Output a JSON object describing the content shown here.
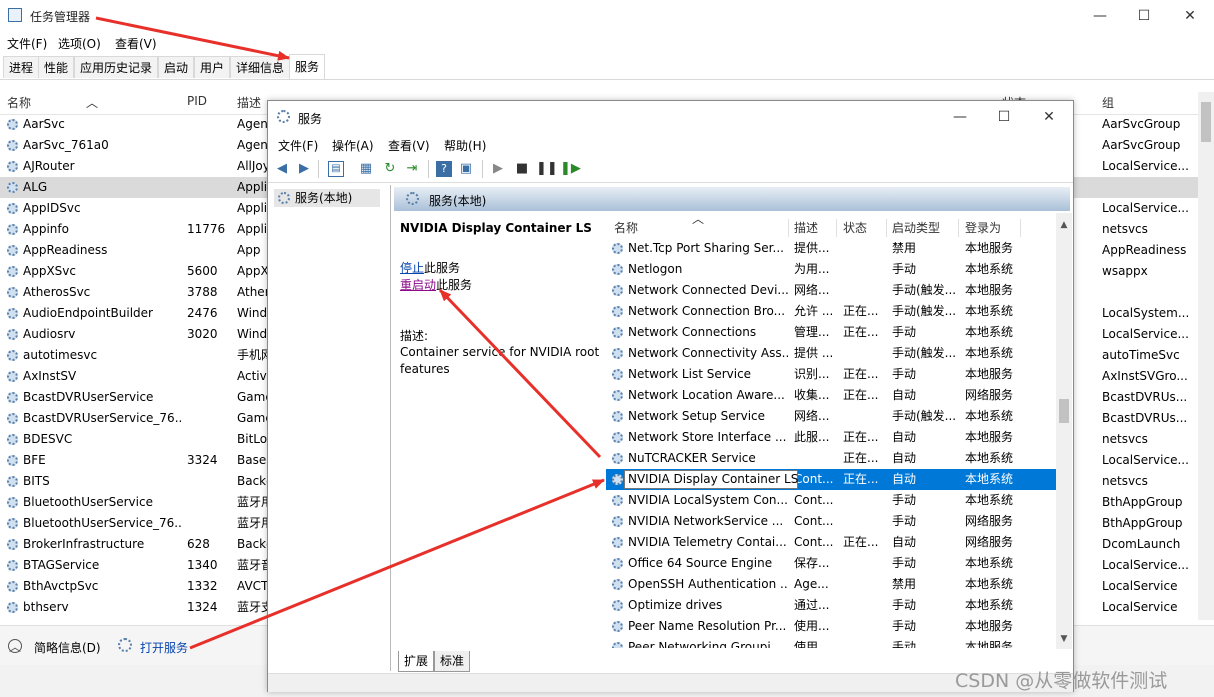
{
  "taskmgr": {
    "title": "任务管理器",
    "controls": {
      "min": "—",
      "max": "☐",
      "close": "✕"
    },
    "menu": [
      "文件(F)",
      "选项(O)",
      "查看(V)"
    ],
    "tabs": [
      "进程",
      "性能",
      "应用历史记录",
      "启动",
      "用户",
      "详细信息",
      "服务"
    ],
    "active_tab": "服务",
    "columns": {
      "name": "名称",
      "pid": "PID",
      "desc": "描述",
      "status": "状态",
      "group": "组"
    },
    "rows": [
      {
        "name": "AarSvc",
        "pid": "",
        "desc": "Agen",
        "group": "AarSvcGroup"
      },
      {
        "name": "AarSvc_761a0",
        "pid": "",
        "desc": "Agen",
        "group": "AarSvcGroup"
      },
      {
        "name": "AJRouter",
        "pid": "",
        "desc": "AllJoy",
        "group": "LocalService..."
      },
      {
        "name": "ALG",
        "pid": "",
        "desc": "Appli",
        "group": ""
      },
      {
        "name": "AppIDSvc",
        "pid": "",
        "desc": "Appli",
        "group": "LocalService..."
      },
      {
        "name": "Appinfo",
        "pid": "11776",
        "desc": "Appli",
        "group": "netsvcs"
      },
      {
        "name": "AppReadiness",
        "pid": "",
        "desc": "App",
        "group": "AppReadiness"
      },
      {
        "name": "AppXSvc",
        "pid": "5600",
        "desc": "AppX",
        "group": "wsappx"
      },
      {
        "name": "AtherosSvc",
        "pid": "3788",
        "desc": "Ather",
        "group": ""
      },
      {
        "name": "AudioEndpointBuilder",
        "pid": "2476",
        "desc": "Wind",
        "group": "LocalSystem..."
      },
      {
        "name": "Audiosrv",
        "pid": "3020",
        "desc": "Wind",
        "group": "LocalService..."
      },
      {
        "name": "autotimesvc",
        "pid": "",
        "desc": "手机网",
        "group": "autoTimeSvc"
      },
      {
        "name": "AxInstSV",
        "pid": "",
        "desc": "Active",
        "group": "AxInstSVGro..."
      },
      {
        "name": "BcastDVRUserService",
        "pid": "",
        "desc": "Game",
        "group": "BcastDVRUs..."
      },
      {
        "name": "BcastDVRUserService_76...",
        "pid": "",
        "desc": "Game",
        "group": "BcastDVRUs..."
      },
      {
        "name": "BDESVC",
        "pid": "",
        "desc": "BitLo",
        "group": "netsvcs"
      },
      {
        "name": "BFE",
        "pid": "3324",
        "desc": "Base",
        "group": "LocalService..."
      },
      {
        "name": "BITS",
        "pid": "",
        "desc": "Backg",
        "group": "netsvcs"
      },
      {
        "name": "BluetoothUserService",
        "pid": "",
        "desc": "蓝牙用",
        "group": "BthAppGroup"
      },
      {
        "name": "BluetoothUserService_76...",
        "pid": "",
        "desc": "蓝牙用",
        "group": "BthAppGroup"
      },
      {
        "name": "BrokerInfrastructure",
        "pid": "628",
        "desc": "Backg",
        "group": "DcomLaunch"
      },
      {
        "name": "BTAGService",
        "pid": "1340",
        "desc": "蓝牙音",
        "group": "LocalService..."
      },
      {
        "name": "BthAvctpSvc",
        "pid": "1332",
        "desc": "AVCT",
        "group": "LocalService"
      },
      {
        "name": "bthserv",
        "pid": "1324",
        "desc": "蓝牙支",
        "group": "LocalService"
      }
    ],
    "selected_row": "ALG",
    "bottom": {
      "brief": "简略信息(D)",
      "open_services": "打开服务"
    }
  },
  "services": {
    "title": "服务",
    "controls": {
      "min": "—",
      "max": "☐",
      "close": "✕"
    },
    "menu": [
      "文件(F)",
      "操作(A)",
      "查看(V)",
      "帮助(H)"
    ],
    "tree_node": "服务(本地)",
    "pane_title": "服务(本地)",
    "detail": {
      "service_name": "NVIDIA Display Container LS",
      "stop_link": "停止",
      "stop_suffix": "此服务",
      "restart_link": "重启动",
      "restart_suffix": "此服务",
      "desc_label": "描述:",
      "desc_text": "Container service for NVIDIA root features"
    },
    "columns": {
      "name": "名称",
      "desc": "描述",
      "status": "状态",
      "startup": "启动类型",
      "logon": "登录为"
    },
    "rows": [
      {
        "name": "Net.Tcp Port Sharing Ser...",
        "desc": "提供...",
        "status": "",
        "startup": "禁用",
        "logon": "本地服务"
      },
      {
        "name": "Netlogon",
        "desc": "为用...",
        "status": "",
        "startup": "手动",
        "logon": "本地系统"
      },
      {
        "name": "Network Connected Devi...",
        "desc": "网络...",
        "status": "",
        "startup": "手动(触发...",
        "logon": "本地服务"
      },
      {
        "name": "Network Connection Bro...",
        "desc": "允许 ...",
        "status": "正在...",
        "startup": "手动(触发...",
        "logon": "本地系统"
      },
      {
        "name": "Network Connections",
        "desc": "管理...",
        "status": "正在...",
        "startup": "手动",
        "logon": "本地系统"
      },
      {
        "name": "Network Connectivity Ass...",
        "desc": "提供 ...",
        "status": "",
        "startup": "手动(触发...",
        "logon": "本地系统"
      },
      {
        "name": "Network List Service",
        "desc": "识别...",
        "status": "正在...",
        "startup": "手动",
        "logon": "本地服务"
      },
      {
        "name": "Network Location Aware...",
        "desc": "收集...",
        "status": "正在...",
        "startup": "自动",
        "logon": "网络服务"
      },
      {
        "name": "Network Setup Service",
        "desc": "网络...",
        "status": "",
        "startup": "手动(触发...",
        "logon": "本地系统"
      },
      {
        "name": "Network Store Interface ...",
        "desc": "此服...",
        "status": "正在...",
        "startup": "自动",
        "logon": "本地服务"
      },
      {
        "name": "NuTCRACKER Service",
        "desc": "",
        "status": "正在...",
        "startup": "自动",
        "logon": "本地系统"
      },
      {
        "name": "NVIDIA Display Container LS",
        "desc": "Cont...",
        "status": "正在...",
        "startup": "自动",
        "logon": "本地系统"
      },
      {
        "name": "NVIDIA LocalSystem Con...",
        "desc": "Cont...",
        "status": "",
        "startup": "手动",
        "logon": "本地系统"
      },
      {
        "name": "NVIDIA NetworkService ...",
        "desc": "Cont...",
        "status": "",
        "startup": "手动",
        "logon": "网络服务"
      },
      {
        "name": "NVIDIA Telemetry Contai...",
        "desc": "Cont...",
        "status": "正在...",
        "startup": "自动",
        "logon": "网络服务"
      },
      {
        "name": "Office 64 Source Engine",
        "desc": "保存...",
        "status": "",
        "startup": "手动",
        "logon": "本地系统"
      },
      {
        "name": "OpenSSH Authentication ...",
        "desc": "Age...",
        "status": "",
        "startup": "禁用",
        "logon": "本地系统"
      },
      {
        "name": "Optimize drives",
        "desc": "通过...",
        "status": "",
        "startup": "手动",
        "logon": "本地系统"
      },
      {
        "name": "Peer Name Resolution Pr...",
        "desc": "使用...",
        "status": "",
        "startup": "手动",
        "logon": "本地服务"
      },
      {
        "name": "Peer Networking Groupi...",
        "desc": "使用...",
        "status": "",
        "startup": "手动",
        "logon": "本地服务"
      }
    ],
    "selected_row": "NVIDIA Display Container LS",
    "tabs": [
      "扩展",
      "标准"
    ]
  },
  "watermark": "CSDN @从零做软件测试",
  "colors": {
    "selection": "#0078d7",
    "arrow": "#e8302a",
    "link": "#0645ad"
  }
}
